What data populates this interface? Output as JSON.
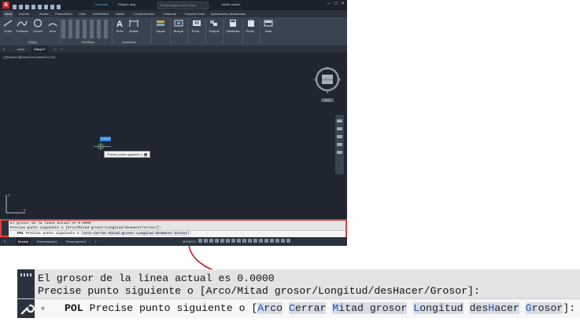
{
  "app": {
    "logo": "A",
    "share_label": "Compartir",
    "file_name": "Dibujo1.dwg",
    "search_placeholder": "Escriba palabra clave o frase",
    "login_label": "Iniciar sesión"
  },
  "ribbon": {
    "tabs": [
      "Inicio",
      "Insertar",
      "Anotar",
      "Paramétrico",
      "Vista",
      "Administrar",
      "Salida",
      "Complementos",
      "Colaborar",
      "Express Tools",
      "Aplicaciones destacadas"
    ],
    "tools": {
      "linea": "Línea",
      "polilinea": "Polilínea",
      "circulo": "Círculo",
      "arco": "Arco",
      "texto": "Texto",
      "acotar": "Acotar",
      "capas": "Capas",
      "bloque": "Bloque",
      "propiedades": "Propi...",
      "grupos": "Grupos",
      "utilidades": "Utilidades",
      "portapapeles": "Porta...",
      "vista": "Vista"
    },
    "panels": {
      "dibujo": "Dibujo",
      "modificar": "Modificar",
      "anotacion": "Anotación"
    }
  },
  "doc_tabs": [
    "Inicio",
    "Dibujo1*"
  ],
  "viewport_label": "[-][Superior][Estructura alámbrica 2D]",
  "viewcube": {
    "face": "SUPERIOR",
    "north": "N",
    "south": "S",
    "east": "E",
    "west": "O",
    "wcs": "WCS"
  },
  "cursor": {
    "input_value": "0.0000",
    "tooltip": "Precise punto siguiente o"
  },
  "ucs": {
    "x": "X",
    "y": "Y"
  },
  "command": {
    "line1": "El grosor de la línea actual es 0.0000",
    "line2": "Precise punto siguiente o [Arco/Mitad grosor/Longitud/desHacer/Grosor]:",
    "prefix": "POL",
    "prompt": "Precise punto siguiente o [",
    "options": [
      {
        "key": "A",
        "rest": "rco"
      },
      {
        "key": "C",
        "rest": "errar"
      },
      {
        "key": "M",
        "rest": "itad grosor"
      },
      {
        "key": "L",
        "rest": "ongitud"
      },
      {
        "key": "H",
        "rest": "acer",
        "pre": "des"
      },
      {
        "key": "G",
        "rest": "rosor"
      }
    ],
    "suffix": "]:"
  },
  "status": {
    "model_tab": "Modelo",
    "layouts": [
      "Presentación1",
      "Presentación2"
    ],
    "model_label": "MODELO"
  },
  "colors": {
    "accent": "#e04040",
    "highlight": "#1f4fbf"
  }
}
